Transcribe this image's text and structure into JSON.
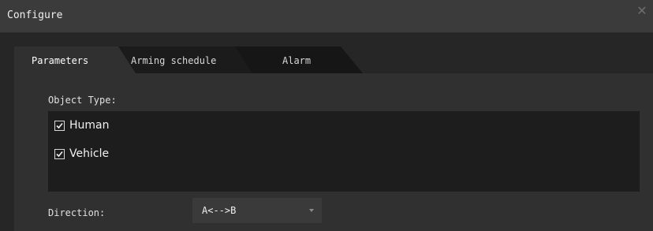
{
  "window": {
    "title": "Configure",
    "close_icon": "close-icon"
  },
  "tabs": [
    {
      "label": "Parameters",
      "active": true
    },
    {
      "label": "Arming schedule",
      "active": false
    },
    {
      "label": "Alarm",
      "active": false
    }
  ],
  "object_type": {
    "label": "Object Type:",
    "options": [
      {
        "label": "Human",
        "checked": true
      },
      {
        "label": "Vehicle",
        "checked": true
      }
    ]
  },
  "direction": {
    "label": "Direction:",
    "value": "A<-->B",
    "icon": "chevron-down-icon"
  },
  "colors": {
    "background": "#262626",
    "titlebar": "#3b3b3b",
    "panel": "#303030",
    "list": "#1d1d1d",
    "inactive_tab": "#161616",
    "select": "#3a3a3a"
  }
}
